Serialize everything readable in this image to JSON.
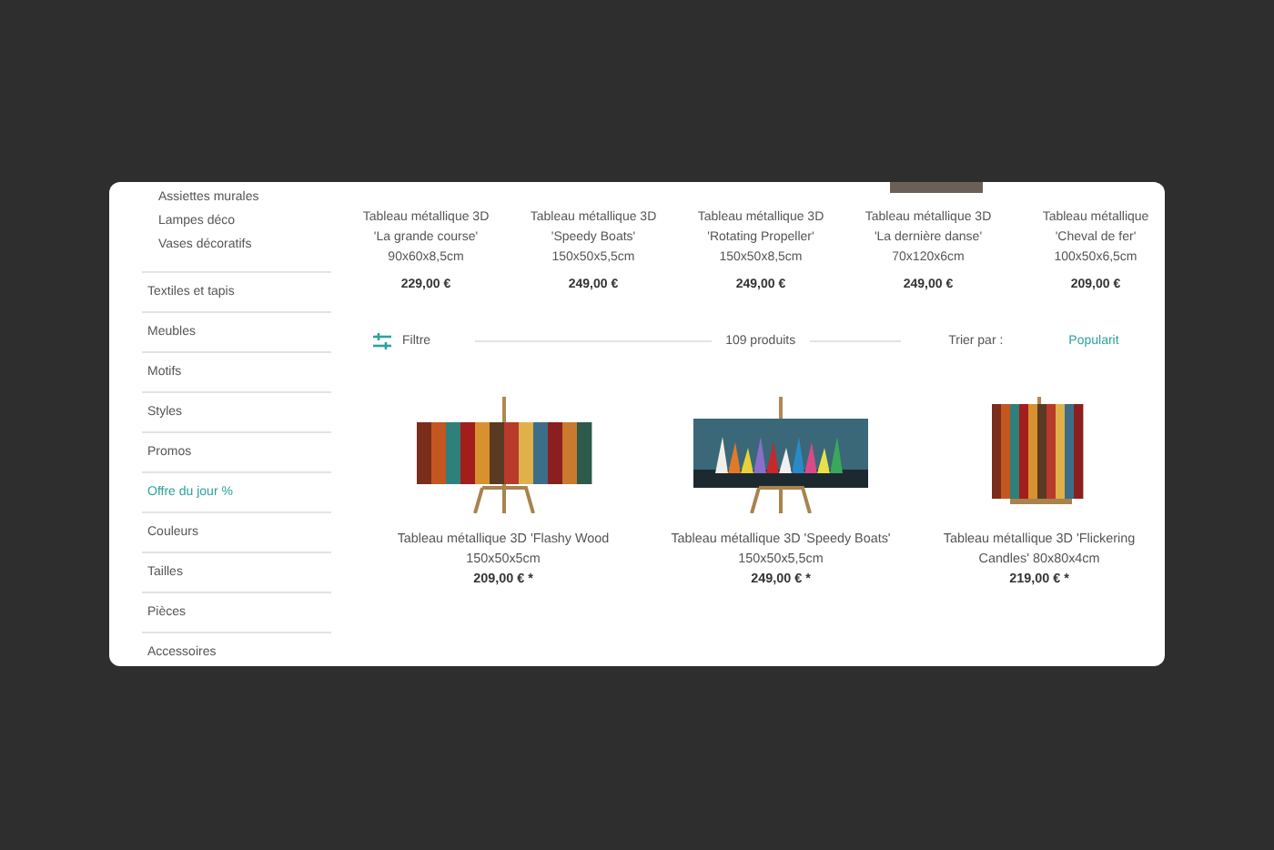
{
  "sidebar": {
    "subitems": [
      "Assiettes murales",
      "Lampes déco",
      "Vases décoratifs"
    ],
    "items": [
      {
        "label": "Textiles et tapis",
        "highlighted": false
      },
      {
        "label": "Meubles",
        "highlighted": false
      },
      {
        "label": "Motifs",
        "highlighted": false
      },
      {
        "label": "Styles",
        "highlighted": false
      },
      {
        "label": "Promos",
        "highlighted": false
      },
      {
        "label": "Offre du jour %",
        "highlighted": true
      },
      {
        "label": "Couleurs",
        "highlighted": false
      },
      {
        "label": "Tailles",
        "highlighted": false
      },
      {
        "label": "Pièces",
        "highlighted": false
      },
      {
        "label": "Accessoires",
        "highlighted": false
      }
    ]
  },
  "top_products": [
    {
      "title": "Tableau métallique 3D 'La grande course'",
      "size": "90x60x8,5cm",
      "price": "229,00 €"
    },
    {
      "title": "Tableau métallique 3D 'Speedy Boats'",
      "size": "150x50x5,5cm",
      "price": "249,00 €"
    },
    {
      "title": "Tableau métallique 3D 'Rotating Propeller'",
      "size": "150x50x8,5cm",
      "price": "249,00 €"
    },
    {
      "title": "Tableau métallique 3D 'La dernière danse'",
      "size": "70x120x6cm",
      "price": "249,00 €"
    },
    {
      "title": "Tableau métallique 'Cheval de fer'",
      "size": "100x50x6,5cm",
      "price": "209,00 €"
    }
  ],
  "toolbar": {
    "filter": "Filtre",
    "count": "109 produits",
    "sort_label": "Trier par :",
    "sort_value": "Popularit"
  },
  "products": [
    {
      "title": "Tableau métallique 3D 'Flashy Wood",
      "size": "150x50x5cm",
      "price": "209,00 € *",
      "kind": "wide"
    },
    {
      "title": "Tableau métallique 3D 'Speedy Boats'",
      "size": "150x50x5,5cm",
      "price": "249,00 € *",
      "kind": "boats"
    },
    {
      "title": "Tableau métallique 3D 'Flickering Candles' 80x80x4cm",
      "price": "219,00 € *",
      "kind": "square"
    }
  ]
}
